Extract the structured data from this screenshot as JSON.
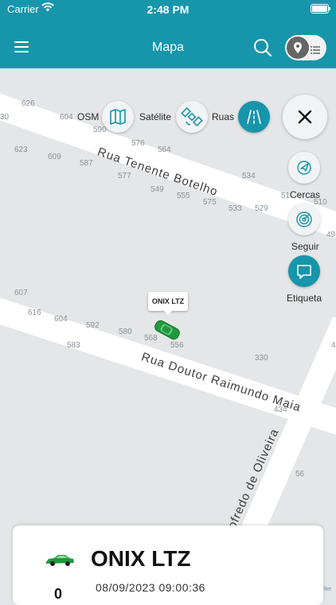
{
  "status_bar": {
    "carrier": "Carrier",
    "time": "2:48 PM"
  },
  "header": {
    "title": "Mapa"
  },
  "map": {
    "house_numbers": [
      {
        "text": "626"
      },
      {
        "text": "604"
      },
      {
        "text": "30"
      },
      {
        "text": "590"
      },
      {
        "text": "576"
      },
      {
        "text": "564"
      },
      {
        "text": "623"
      },
      {
        "text": "609"
      },
      {
        "text": "587"
      },
      {
        "text": "577"
      },
      {
        "text": "549"
      },
      {
        "text": "555"
      },
      {
        "text": "575"
      },
      {
        "text": "533"
      },
      {
        "text": "529"
      },
      {
        "text": "534"
      },
      {
        "text": "51"
      },
      {
        "text": "510"
      },
      {
        "text": "49"
      },
      {
        "text": "607"
      },
      {
        "text": "616"
      },
      {
        "text": "604"
      },
      {
        "text": "592"
      },
      {
        "text": "580"
      },
      {
        "text": "568"
      },
      {
        "text": "556"
      },
      {
        "text": "583"
      },
      {
        "text": "330"
      },
      {
        "text": "434"
      },
      {
        "text": "56"
      },
      {
        "text": "4"
      }
    ],
    "streets": [
      "Rua Tenente Botelho",
      "Rua Doutor Raimundo Maia",
      "odofredo de Oliveira"
    ],
    "attribution": "flet"
  },
  "layers": {
    "osm": "OSM",
    "satellite": "Satélite",
    "streets": "Ruas"
  },
  "actions": {
    "fences": "Cercas",
    "follow": "Seguir",
    "label": "Etiqueta"
  },
  "marker": {
    "label": "ONIX LTZ"
  },
  "vehicle_card": {
    "name": "ONIX LTZ",
    "datetime": "08/09/2023 09:00:36",
    "speed": "0"
  },
  "colors": {
    "accent": "#1795ab",
    "vehicle": "#1f9a3c"
  }
}
